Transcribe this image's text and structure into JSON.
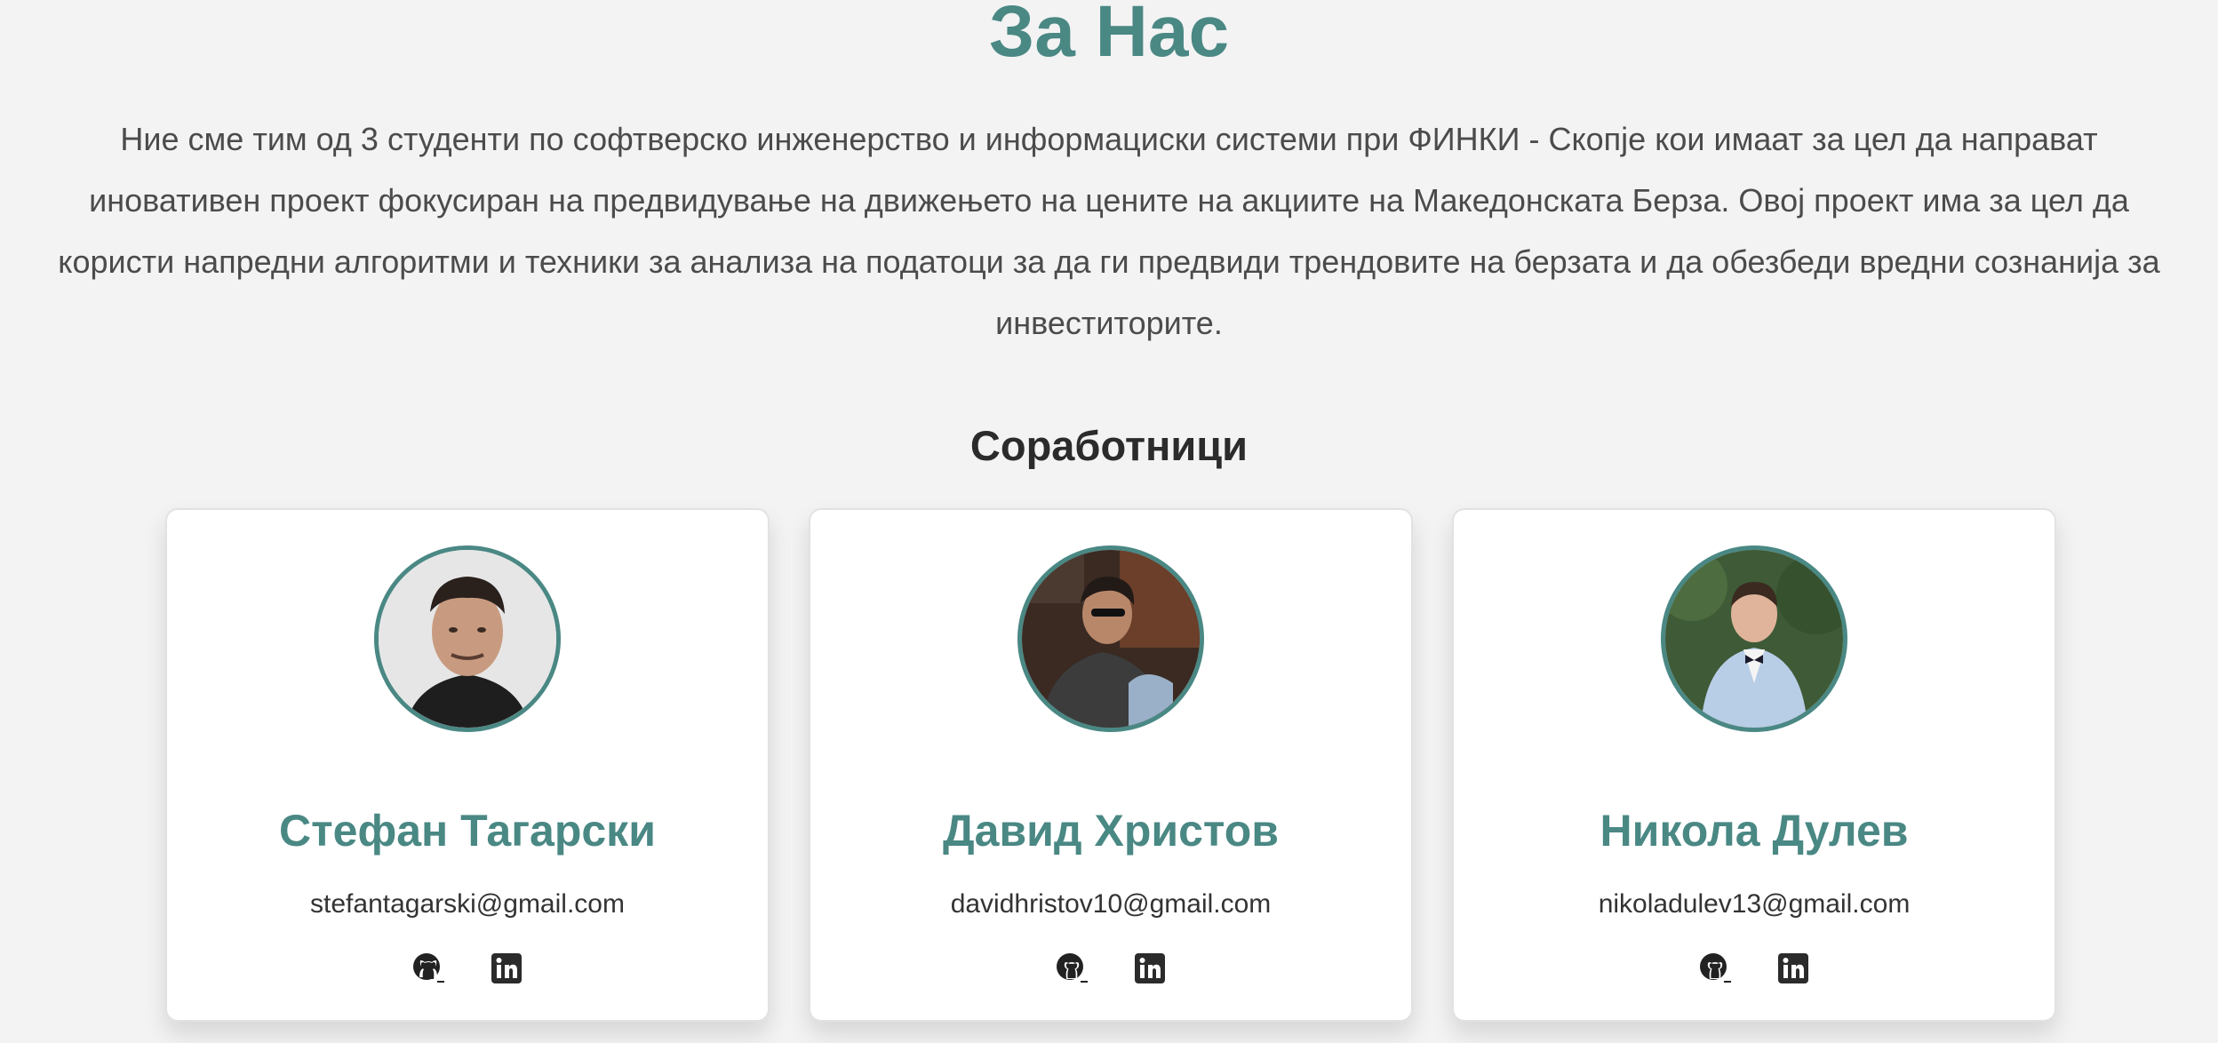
{
  "about": {
    "title": "За Нас",
    "description": "Ние сме тим од 3 студенти по софтверско инженерство и информациски системи при ФИНКИ - Скопје кои имаат за цел да направат иновативен проект фокусиран на предвидување на движењето на цените на акциите на Македонската Берза. Овој проект има за цел да користи напредни алгоритми и техники за анализа на податоци за да ги предвиди трендовите на берзата и да обезбеди вредни сознанија за инвеститорите."
  },
  "collaborators": {
    "title": "Соработници",
    "members": [
      {
        "name": "Стефан Тагарски",
        "email": "stefantagarski@gmail.com",
        "icons": [
          "github-icon",
          "linkedin-icon"
        ]
      },
      {
        "name": "Давид Христов",
        "email": "davidhristov10@gmail.com",
        "icons": [
          "github-icon",
          "linkedin-icon"
        ]
      },
      {
        "name": "Никола Дулев",
        "email": "nikoladulev13@gmail.com",
        "icons": [
          "github-icon",
          "linkedin-icon"
        ]
      }
    ]
  },
  "colors": {
    "accent": "#4a8884",
    "background": "#f3f3f3",
    "card": "#ffffff",
    "text": "#4b4b4b"
  }
}
